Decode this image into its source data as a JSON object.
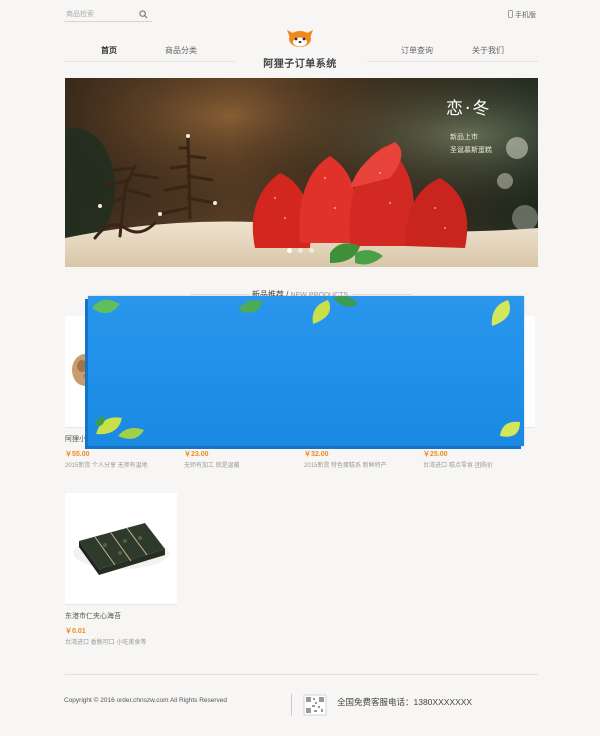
{
  "top": {
    "search_placeholder": "商品检索",
    "mobile_label": "手机版"
  },
  "nav": {
    "home": "首页",
    "categories": "商品分类",
    "site_title": "阿狸子订单系统",
    "order_query": "订单查询",
    "about": "关于我们"
  },
  "banner": {
    "heading": "恋·冬",
    "sub1": "新品上市",
    "sub2": "圣诞慕斯蛋糕",
    "dot_count": 3,
    "active_dot": 0
  },
  "section": {
    "title_cn": "新品推荐",
    "title_sep": " / ",
    "title_en": "NEW PRODUCTS"
  },
  "products": [
    {
      "name": "阿狸小面包",
      "price": "￥55.00",
      "desc": "2015新货 个人分享 无师有温地"
    },
    {
      "name": "",
      "price": "￥23.00",
      "desc": "无师有加工 就是温暖"
    },
    {
      "name": "",
      "price": "￥32.00",
      "desc": "2015新货 特色蛋糕系 新鲜特产"
    },
    {
      "name": "",
      "price": "￥25.00",
      "desc": "台湾进口·糕点零食·团购价"
    },
    {
      "name": "东港市仁夹心海苔",
      "price": "￥0.01",
      "desc": "台湾进口 香脆可口 小吃美食等"
    }
  ],
  "footer": {
    "copyright": "Copyright © 2016 order.chnszw.com All Rights Reserved",
    "hotline": "全国免费客服电话：1380XXXXXXX"
  },
  "colors": {
    "accent": "#f08a1c",
    "popup": "#1e8fe8",
    "background": "#f7f6f5"
  }
}
